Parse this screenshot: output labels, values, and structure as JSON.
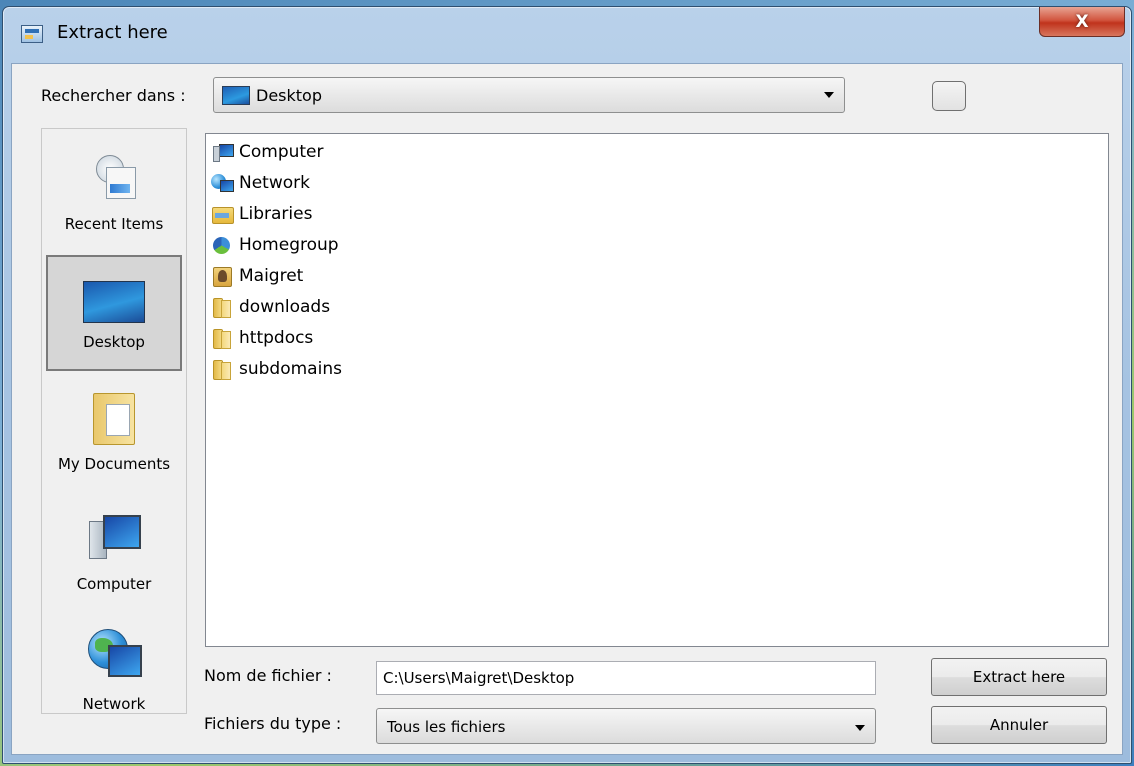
{
  "window": {
    "title": "Extract here",
    "close_glyph": "X"
  },
  "lookin": {
    "label": "Rechercher dans :",
    "value": "Desktop"
  },
  "places": [
    {
      "label": "Recent Items",
      "icon": "recent-items-icon"
    },
    {
      "label": "Desktop",
      "icon": "desktop-icon",
      "selected": true
    },
    {
      "label": "My Documents",
      "icon": "my-documents-icon"
    },
    {
      "label": "Computer",
      "icon": "computer-icon"
    },
    {
      "label": "Network",
      "icon": "network-icon"
    }
  ],
  "files": [
    {
      "label": "Computer",
      "icon": "computer-icon"
    },
    {
      "label": "Network",
      "icon": "network-icon"
    },
    {
      "label": "Libraries",
      "icon": "libraries-icon"
    },
    {
      "label": "Homegroup",
      "icon": "homegroup-icon"
    },
    {
      "label": "Maigret",
      "icon": "user-folder-icon"
    },
    {
      "label": "downloads",
      "icon": "folder-icon"
    },
    {
      "label": "httpdocs",
      "icon": "folder-icon"
    },
    {
      "label": "subdomains",
      "icon": "folder-icon"
    }
  ],
  "filename": {
    "label": "Nom de fichier :",
    "value": "C:\\Users\\Maigret\\Desktop"
  },
  "filetype": {
    "label": "Fichiers du type :",
    "value": "Tous les fichiers"
  },
  "buttons": {
    "extract": "Extract here",
    "cancel": "Annuler"
  }
}
